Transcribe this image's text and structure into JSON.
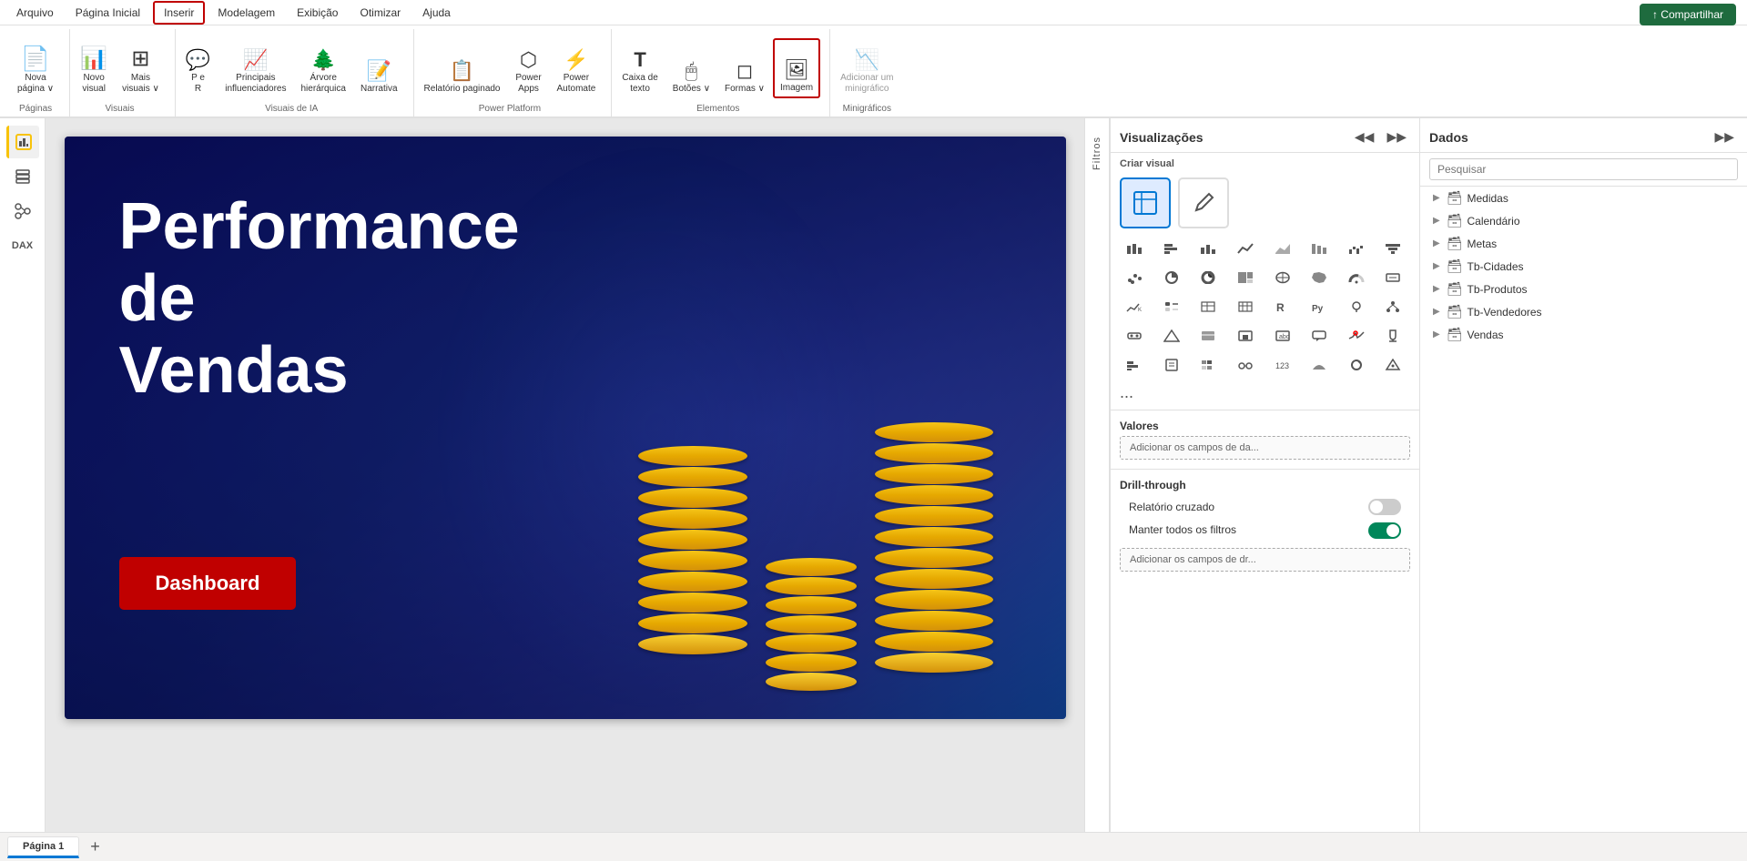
{
  "menu": {
    "items": [
      "Arquivo",
      "Página Inicial",
      "Inserir",
      "Modelagem",
      "Exibição",
      "Otimizar",
      "Ajuda"
    ],
    "active": "Inserir"
  },
  "ribbon": {
    "share_label": "↑ Compartilhar",
    "groups": [
      {
        "label": "Páginas",
        "buttons": [
          {
            "id": "nova-pagina",
            "icon": "📄",
            "label": "Nova\npágina",
            "small": false
          }
        ]
      },
      {
        "label": "Visuais",
        "buttons": [
          {
            "id": "novo-visual",
            "icon": "📊",
            "label": "Novo\nvisual",
            "small": false
          },
          {
            "id": "mais-visuais",
            "icon": "🔢",
            "label": "Mais\nvisuais ∨",
            "small": false
          }
        ]
      },
      {
        "label": "Visuais de IA",
        "buttons": [
          {
            "id": "per",
            "icon": "🅿",
            "label": "P e\nR",
            "small": false
          },
          {
            "id": "principais-influenciadores",
            "icon": "📈",
            "label": "Principais\ninfluenciadores",
            "small": false
          },
          {
            "id": "arvore-hierarquica",
            "icon": "🌳",
            "label": "Árvore\nhierárquica",
            "small": false
          },
          {
            "id": "narrativa",
            "icon": "📝",
            "label": "Narrativa",
            "small": false
          }
        ]
      },
      {
        "label": "Power Platform",
        "buttons": [
          {
            "id": "relatorio-paginado",
            "icon": "📋",
            "label": "Relatório paginado",
            "small": false
          },
          {
            "id": "power-apps",
            "icon": "⬡",
            "label": "Power\nApps",
            "small": false
          },
          {
            "id": "power-automate",
            "icon": "⚡",
            "label": "Power\nAutomate",
            "small": false
          }
        ]
      },
      {
        "label": "Elementos",
        "buttons": [
          {
            "id": "caixa-texto",
            "icon": "T",
            "label": "Caixa de\ntexto",
            "small": false
          },
          {
            "id": "botoes",
            "icon": "🖱",
            "label": "Botões ∨",
            "small": false
          },
          {
            "id": "formas",
            "icon": "◻",
            "label": "Formas ∨",
            "small": false
          },
          {
            "id": "imagem",
            "icon": "🖼",
            "label": "Imagem",
            "small": false,
            "highlighted": true
          }
        ]
      },
      {
        "label": "Minigráficos",
        "buttons": [
          {
            "id": "adicionar-minigrafico",
            "icon": "📉",
            "label": "Adicionar um\nminigráfico",
            "small": false,
            "disabled": true
          }
        ]
      }
    ]
  },
  "canvas": {
    "title_line1": "Performance",
    "title_line2": "de",
    "title_line3": "Vendas",
    "button_label": "Dashboard"
  },
  "viz_panel": {
    "title": "Visualizações",
    "create_visual_label": "Criar visual",
    "values_label": "Valores",
    "values_placeholder": "Adicionar os campos de da...",
    "drill_through_label": "Drill-through",
    "relatorio_cruzado_label": "Relatório cruzado",
    "manter_filtros_label": "Manter todos os\nfiltros",
    "drill_placeholder": "Adicionar os campos de dr..."
  },
  "data_panel": {
    "title": "Dados",
    "search_placeholder": "Pesquisar",
    "tree_items": [
      {
        "id": "medidas",
        "label": "Medidas",
        "icon": "🗃"
      },
      {
        "id": "calendario",
        "label": "Calendário",
        "icon": "🗃"
      },
      {
        "id": "metas",
        "label": "Metas",
        "icon": "🗃"
      },
      {
        "id": "tb-cidades",
        "label": "Tb-Cidades",
        "icon": "🗃"
      },
      {
        "id": "tb-produtos",
        "label": "Tb-Produtos",
        "icon": "🗃"
      },
      {
        "id": "tb-vendedores",
        "label": "Tb-Vendedores",
        "icon": "🗃"
      },
      {
        "id": "vendas",
        "label": "Vendas",
        "icon": "🗃"
      }
    ]
  },
  "filters": {
    "label": "Filtros"
  },
  "page_tabs": [
    {
      "id": "tab1",
      "label": "Página 1",
      "active": true
    }
  ],
  "icons": {
    "expand": "▶",
    "collapse": "◀",
    "chevron_right": "›",
    "chevron_down": "⌄",
    "search": "🔍",
    "database": "🗄",
    "table": "⊞"
  },
  "viz_icons_rows": [
    [
      "⬛",
      "📊",
      "📋",
      "📊",
      "📊",
      "📊",
      "📊",
      "📊"
    ],
    [
      "📈",
      "⛰",
      "📈",
      "▦",
      "◩",
      "⊠",
      "⬜",
      "⬛"
    ],
    [
      "📊",
      "⬜",
      "📉",
      "◎",
      "⭕",
      "⬛",
      "⬜",
      "⬛"
    ],
    [
      "⬜",
      "❓",
      "⬜",
      "⬜",
      "🔡",
      "⬜",
      "⬜",
      "⬜"
    ],
    [
      "🐍",
      "⬛",
      "⬜",
      "⬜",
      "📈",
      "⬛",
      "⬛",
      "🏆"
    ],
    [
      "📊",
      "⬜",
      "⬛",
      "⬜",
      "🔡",
      "⬜",
      "⬜",
      "⬜"
    ],
    [
      "⬛",
      "⬜",
      "⬛",
      "◈",
      "⬜",
      "⬛",
      "⬛",
      "⬛"
    ]
  ]
}
